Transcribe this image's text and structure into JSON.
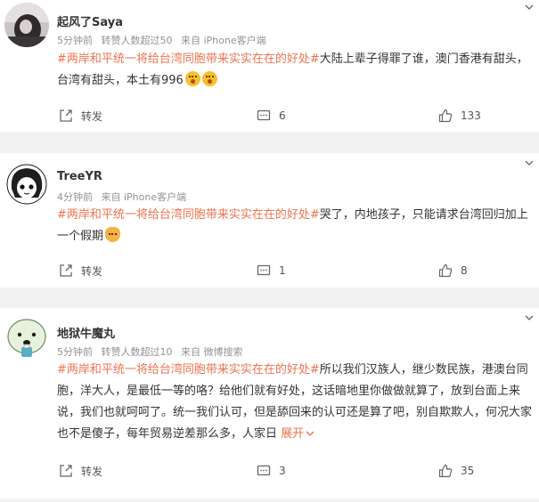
{
  "comments": [
    {
      "username": "起风了Saya",
      "time": "5分钟前",
      "likes_label": "转赞人数超过50",
      "source": "来自 iPhone客户端",
      "hashtag": "#两岸和平统一将给台湾同胞带来实实在在的好处#",
      "text": "大陆上辈子得罪了谁，澳门香港有甜头，台湾有甜头，本土有996",
      "share_label": "转发",
      "comment_count": "6",
      "like_count": "133"
    },
    {
      "username": "TreeYR",
      "time": "4分钟前",
      "source": "来自 iPhone客户端",
      "hashtag": "#两岸和平统一将给台湾同胞带来实实在在的好处#",
      "text": "哭了，内地孩子，只能请求台湾回归加上一个假期",
      "share_label": "转发",
      "comment_count": "1",
      "like_count": "8"
    },
    {
      "username": "地狱牛魔丸",
      "time": "5分钟前",
      "likes_label": "转赞人数超过10",
      "source": "来自 微博搜索",
      "hashtag": "#两岸和平统一将给台湾同胞带来实实在在的好处#",
      "text": "所以我们汉族人，继少数民族，港澳台同胞，洋大人，是最低一等的咯？给他们就有好处，这话暗地里你做做就算了，放到台面上来说，我们也就呵呵了。统一我们认可，但是舔回来的认可还是算了吧，别自欺欺人，何况大家也不是傻子，每年贸易逆差那么多，人家日",
      "expand_label": "展开",
      "share_label": "转发",
      "comment_count": "3",
      "like_count": "35"
    }
  ],
  "icons": {
    "share": "share-icon",
    "comment": "comment-icon",
    "like": "thumbs-up-icon",
    "menu": "chevron-down-icon",
    "emoji_1": "shocked-face-emoji",
    "emoji_2": "cat-face-emoji"
  },
  "colors": {
    "hashtag": "#eb7350",
    "meta": "#939393",
    "background": "#f2f2f2",
    "card": "#ffffff"
  }
}
